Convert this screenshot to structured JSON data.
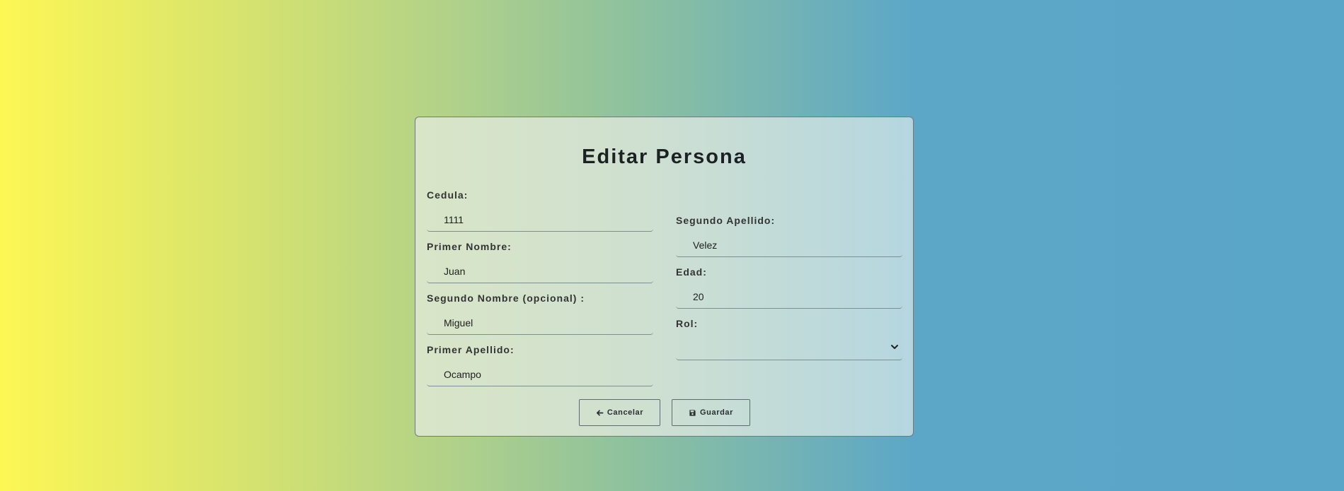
{
  "form": {
    "title": "Editar Persona",
    "fields": {
      "cedula": {
        "label": "Cedula:",
        "value": "1111"
      },
      "primer_nombre": {
        "label": "Primer Nombre:",
        "value": "Juan"
      },
      "segundo_nombre": {
        "label": "Segundo Nombre (opcional) :",
        "value": "Miguel"
      },
      "primer_apellido": {
        "label": "Primer Apellido:",
        "value": "Ocampo"
      },
      "segundo_apellido": {
        "label": "Segundo Apellido:",
        "value": "Velez"
      },
      "edad": {
        "label": "Edad:",
        "value": "20"
      },
      "rol": {
        "label": "Rol:",
        "value": ""
      }
    },
    "buttons": {
      "cancel_label": "Cancelar",
      "save_label": "Guardar",
      "cancel_icon": "arrow-left-icon",
      "save_icon": "floppy-disk-icon"
    }
  },
  "colors": {
    "gradient_start": "#fdf755",
    "gradient_end": "#5aa6c8",
    "title_color": "#1c2224"
  }
}
